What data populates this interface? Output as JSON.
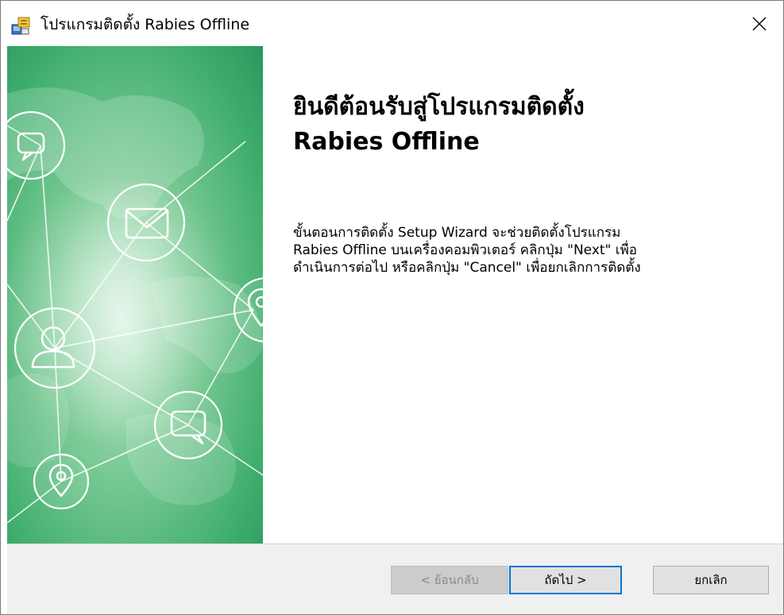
{
  "window": {
    "title": "โปรแกรมติดตั้ง Rabies Offline",
    "close_glyph": "✕"
  },
  "content": {
    "heading_line1": "ยินดีต้อนรับสู่โปรแกรมติดตั้ง",
    "heading_line2": "Rabies Offline",
    "body_line1": "ขั้นตอนการติดตั้ง Setup Wizard จะช่วยติดตั้งโปรแกรม",
    "body_line2": "Rabies Offline บนเครื่องคอมพิวเตอร์  คลิกปุ่ม \"Next\" เพื่อ",
    "body_line3": "ดำเนินการต่อไป หรือคลิกปุ่ม \"Cancel\" เพื่อยกเลิกการติดตั้ง"
  },
  "buttons": {
    "back_label": "< ย้อนกลับ",
    "next_label": "ถัดไป >",
    "cancel_label": "ยกเลิก"
  },
  "banner": {
    "icons": [
      "chat-bubble-icon",
      "mail-icon",
      "location-pin-icon",
      "user-icon",
      "chat-bubble-icon",
      "location-pin-icon"
    ]
  },
  "colors": {
    "banner_green_light": "#8fd4a8",
    "banner_green_dark": "#2e9e5f",
    "focus_blue": "#0078d7"
  }
}
